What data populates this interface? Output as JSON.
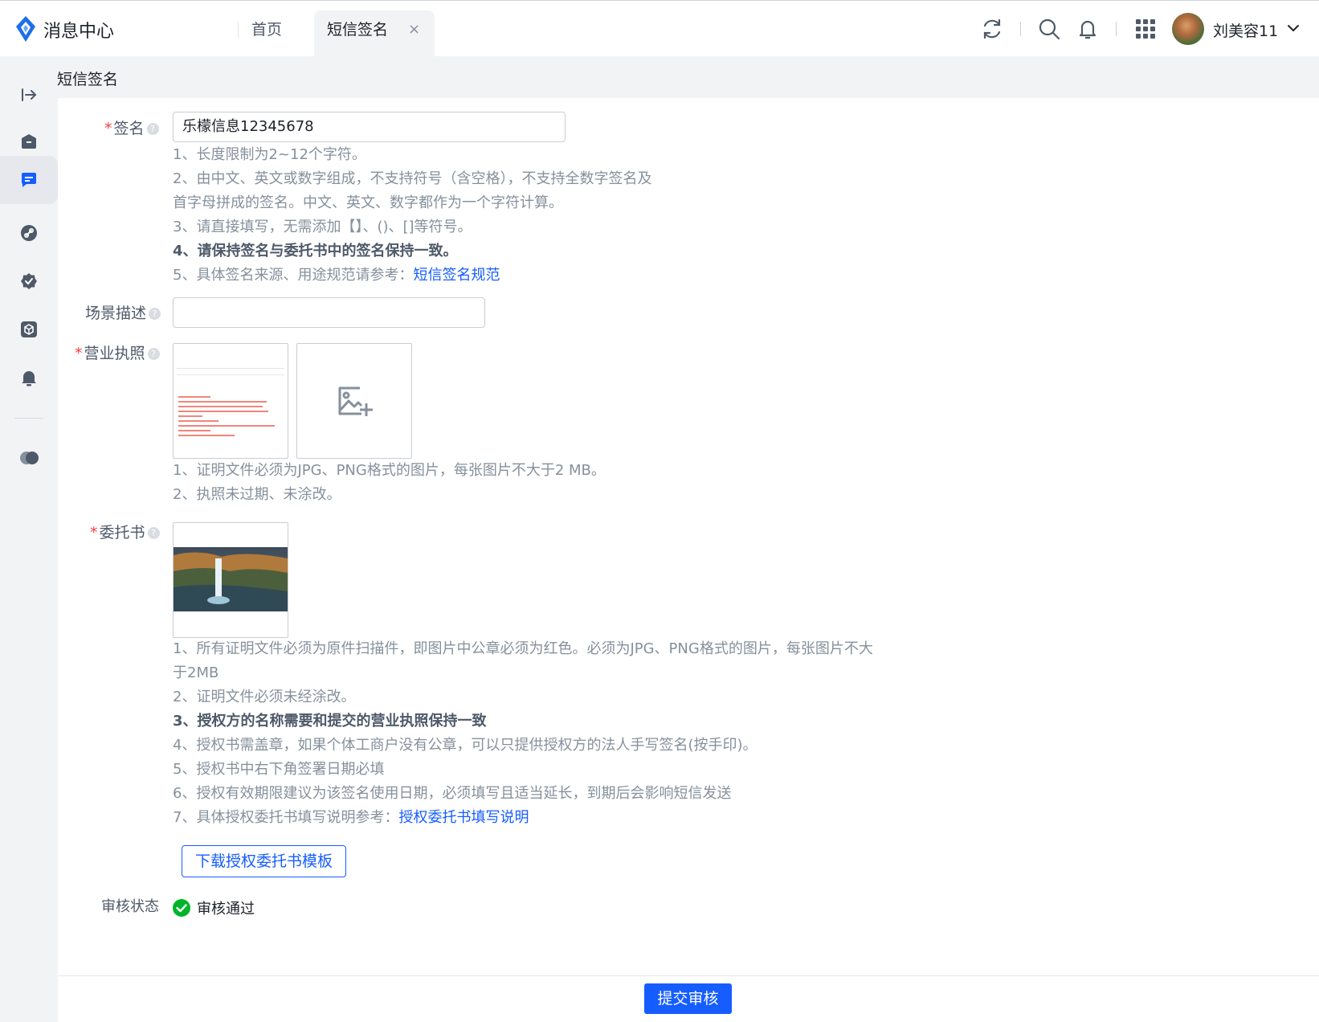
{
  "app": {
    "title": "消息中心"
  },
  "tabs": [
    {
      "label": "首页"
    },
    {
      "label": "短信签名",
      "close": "×"
    }
  ],
  "user": {
    "name": "刘美容11"
  },
  "header_icons": [
    "refresh-icon",
    "search-icon",
    "bell-icon",
    "apps-grid-icon"
  ],
  "sidebar_icons": [
    "expand-icon",
    "box-icon",
    "message-icon",
    "link-icon",
    "badge-check-icon",
    "cube-icon",
    "bell-icon",
    "toggle-icon"
  ],
  "breadcrumb": "短信签名",
  "form": {
    "signature": {
      "label": "签名",
      "value": "乐檬信息12345678",
      "hints": [
        "1、长度限制为2~12个字符。",
        "2、由中文、英文或数字组成，不支持符号（含空格），不支持全数字签名及",
        "首字母拼成的签名。中文、英文、数字都作为一个字符计算。",
        "3、请直接填写，无需添加【】、()、[]等符号。",
        "4、请保持签名与委托书中的签名保持一致。",
        "5、具体签名来源、用途规范请参考："
      ],
      "link": "短信签名规范"
    },
    "scene": {
      "label": "场景描述",
      "value": ""
    },
    "license": {
      "label": "营业执照",
      "hints": [
        "1、证明文件必须为JPG、PNG格式的图片，每张图片不大于2 MB。",
        "2、执照未过期、未涂改。"
      ]
    },
    "authorization": {
      "label": "委托书",
      "hints": [
        "1、所有证明文件必须为原件扫描件，即图片中公章必须为红色。必须为JPG、PNG格式的图片，每张图片不大",
        "于2MB",
        "2、证明文件必须未经涂改。",
        "3、授权方的名称需要和提交的营业执照保持一致",
        "4、授权书需盖章，如果个体工商户没有公章，可以只提供授权方的法人手写签名(按手印)。",
        "5、授权书中右下角签署日期必填",
        "6、授权有效期限建议为该签名使用日期，必须填写且适当延长，到期后会影响短信发送",
        "7、具体授权委托书填写说明参考："
      ],
      "link": "授权委托书填写说明",
      "download_button": "下载授权委托书模板"
    },
    "review": {
      "label": "审核状态",
      "status": "审核通过"
    }
  },
  "submit_button": "提交审核",
  "colors": {
    "primary": "#165dff",
    "required": "#f53f3f",
    "success": "#00b42a"
  }
}
